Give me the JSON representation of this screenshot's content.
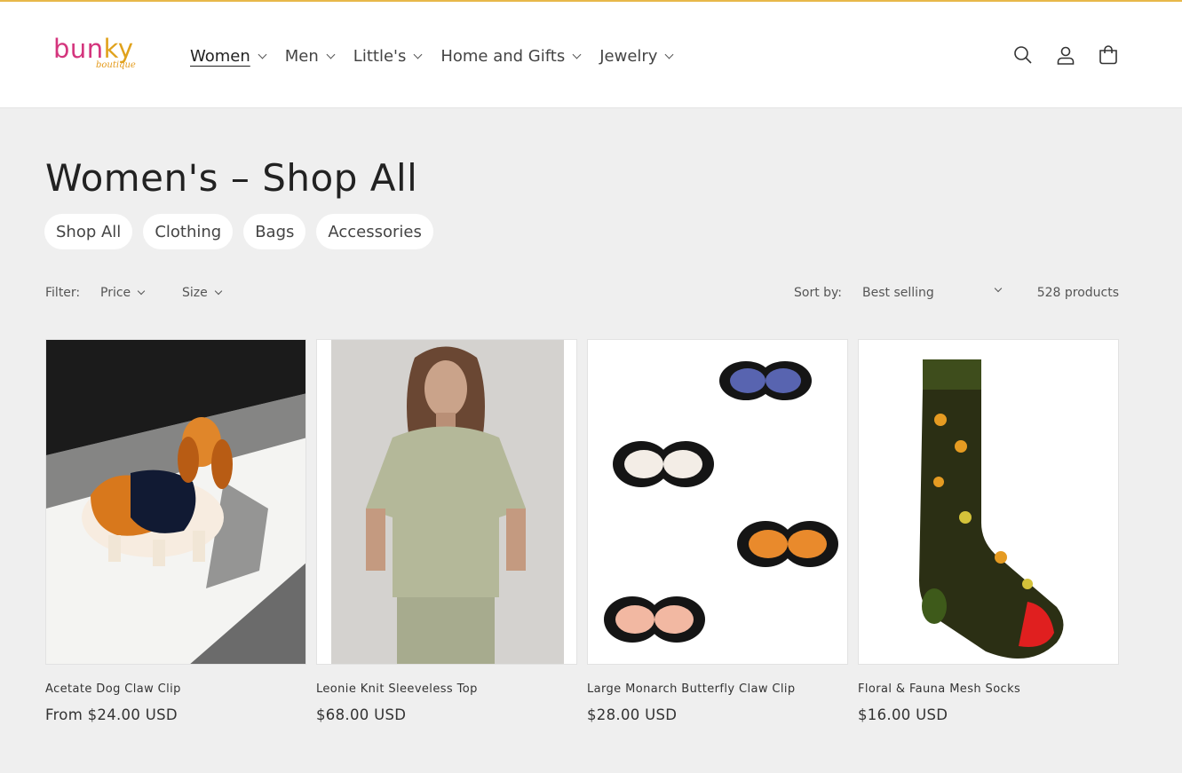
{
  "brand": {
    "name_part1": "bun",
    "name_part2": "ky",
    "tagline": "boutique"
  },
  "nav": {
    "items": [
      {
        "label": "Women",
        "active": true
      },
      {
        "label": "Men"
      },
      {
        "label": "Little's"
      },
      {
        "label": "Home and Gifts"
      },
      {
        "label": "Jewelry"
      }
    ]
  },
  "header_icons": [
    "search-icon",
    "account-icon",
    "cart-icon"
  ],
  "collection": {
    "title": "Women's – Shop All",
    "subcategories": [
      "Shop All",
      "Clothing",
      "Bags",
      "Accessories"
    ]
  },
  "filters": {
    "label": "Filter:",
    "facets": [
      "Price",
      "Size"
    ],
    "sort_label": "Sort by:",
    "sort_value": "Best selling",
    "product_count": "528 products"
  },
  "products": [
    {
      "name": "Acetate Dog Claw Clip",
      "price": "From $24.00 USD"
    },
    {
      "name": "Leonie Knit Sleeveless Top",
      "price": "$68.00 USD"
    },
    {
      "name": "Large Monarch Butterfly Claw Clip",
      "price": "$28.00 USD"
    },
    {
      "name": "Floral & Fauna Mesh Socks",
      "price": "$16.00 USD"
    }
  ],
  "colors": {
    "accent_top_border": "#e8b84a",
    "logo_pink": "#d4357d",
    "logo_orange": "#e0a21c",
    "page_bg": "#efefef"
  }
}
